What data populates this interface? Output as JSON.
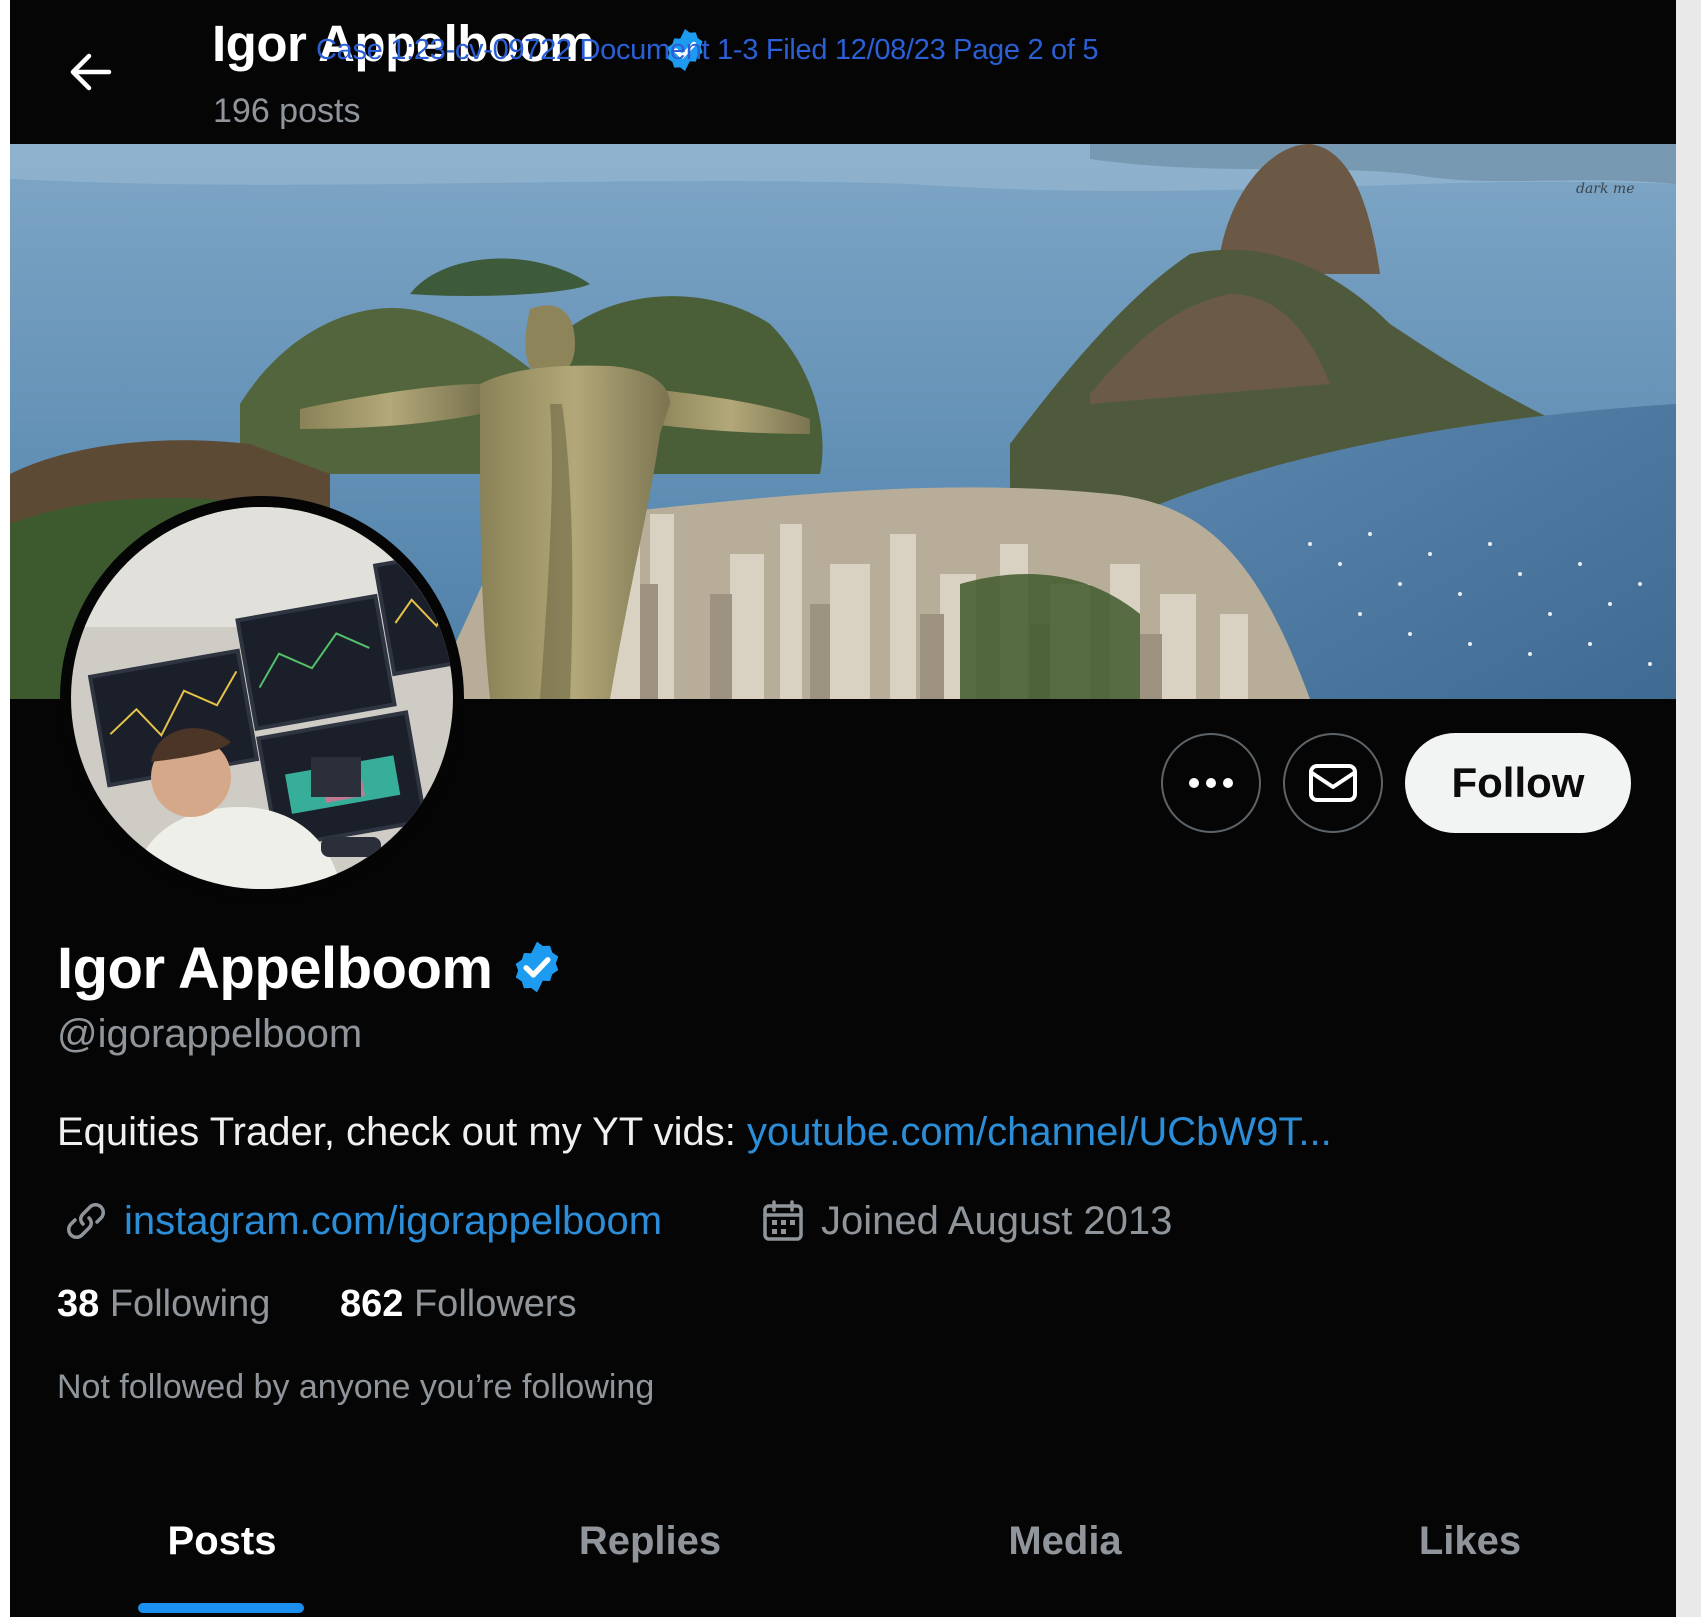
{
  "header": {
    "name": "Igor Appelboom",
    "posts_count": "196 posts",
    "court_stamp": "Case 1:23-cv-09722 Document 1-3 Filed 12/08/23 Page 2 of 5"
  },
  "banner": {
    "signature": "dark me"
  },
  "actions": {
    "more_icon": "more-horizontal-icon",
    "message_icon": "envelope-icon",
    "follow_label": "Follow"
  },
  "profile": {
    "name": "Igor Appelboom",
    "handle": "@igorappelboom",
    "bio_text": "Equities Trader, check out my YT vids: ",
    "bio_link": "youtube.com/channel/UCbW9T...",
    "website": "instagram.com/igorappelboom",
    "joined": "Joined August 2013",
    "following_count": "38",
    "following_label": "Following",
    "followers_count": "862",
    "followers_label": "Followers",
    "not_followed_text": "Not followed by anyone you’re following"
  },
  "tabs": [
    {
      "label": "Posts",
      "active": true
    },
    {
      "label": "Replies",
      "active": false
    },
    {
      "label": "Media",
      "active": false
    },
    {
      "label": "Likes",
      "active": false
    }
  ],
  "colors": {
    "background": "#050505",
    "link": "#2c8ed8",
    "verified_badge": "#1d9bf0",
    "tab_indicator": "#1d8ff0",
    "secondary_text": "#8f959a"
  }
}
